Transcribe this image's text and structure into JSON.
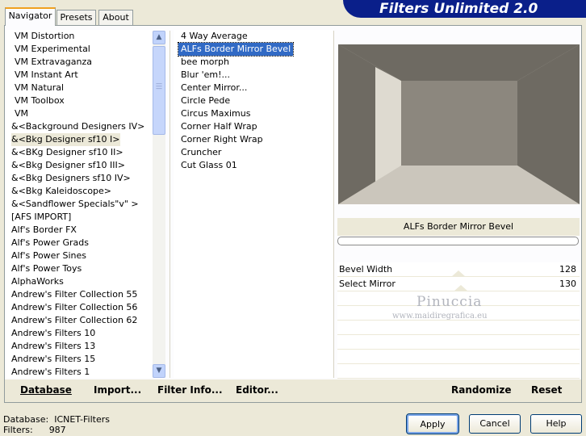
{
  "window": {
    "title": "Filters Unlimited 2.0"
  },
  "tabs": [
    {
      "label": "Navigator",
      "active": true
    },
    {
      "label": "Presets",
      "active": false
    },
    {
      "label": "About",
      "active": false
    }
  ],
  "categories": {
    "items": [
      "VM Distortion",
      "VM Experimental",
      "VM Extravaganza",
      "VM Instant Art",
      "VM Natural",
      "VM Toolbox",
      "VM",
      "&<Background Designers IV>",
      "&<Bkg Designer sf10 I>",
      "&<BKg Designer sf10 II>",
      "&<Bkg Designer sf10 III>",
      "&<Bkg Designers sf10 IV>",
      "&<Bkg Kaleidoscope>",
      "&<Sandflower Specials\"v\" >",
      "[AFS IMPORT]",
      "Alf's Border FX",
      "Alf's Power Grads",
      "Alf's Power Sines",
      "Alf's Power Toys",
      "AlphaWorks",
      "Andrew's Filter Collection 55",
      "Andrew's Filter Collection 56",
      "Andrew's Filter Collection 62",
      "Andrew's Filters 10",
      "Andrew's Filters 13",
      "Andrew's Filters 15",
      "Andrew's Filters 1"
    ],
    "selected_index": 8
  },
  "filters": {
    "items": [
      "4 Way Average",
      "ALFs Border Mirror Bevel",
      "bee morph",
      "Blur 'em!...",
      "Center Mirror...",
      "Circle Pede",
      "Circus Maximus",
      "Corner Half Wrap",
      "Corner Right Wrap",
      "Cruncher",
      "Cut Glass 01"
    ],
    "selected_index": 1
  },
  "preview": {
    "filter_name": "ALFs Border Mirror Bevel",
    "colors": {
      "back_wall": "#8c877e",
      "left_panel": "#dedad0",
      "floor": "#cbc6bc",
      "side": "#6e6a62"
    }
  },
  "parameters": [
    {
      "label": "Bevel Width",
      "value": "128",
      "level": 0.5
    },
    {
      "label": "Select Mirror",
      "value": "130",
      "level": 0.51
    }
  ],
  "watermark": {
    "name": "Pinuccia",
    "url": "www.maidiregrafica.eu"
  },
  "toolbar": {
    "database": "Database",
    "import": "Import...",
    "filter_info": "Filter Info...",
    "editor": "Editor...",
    "randomize": "Randomize",
    "reset": "Reset"
  },
  "status": {
    "database_label": "Database:",
    "database_value": "ICNET-Filters",
    "filters_label": "Filters:",
    "filters_value": "987"
  },
  "buttons": {
    "apply": "Apply",
    "cancel": "Cancel",
    "help": "Help"
  },
  "colors": {
    "banner": "#0a1f8a",
    "selection": "#316ac5",
    "face": "#ece9d8"
  }
}
